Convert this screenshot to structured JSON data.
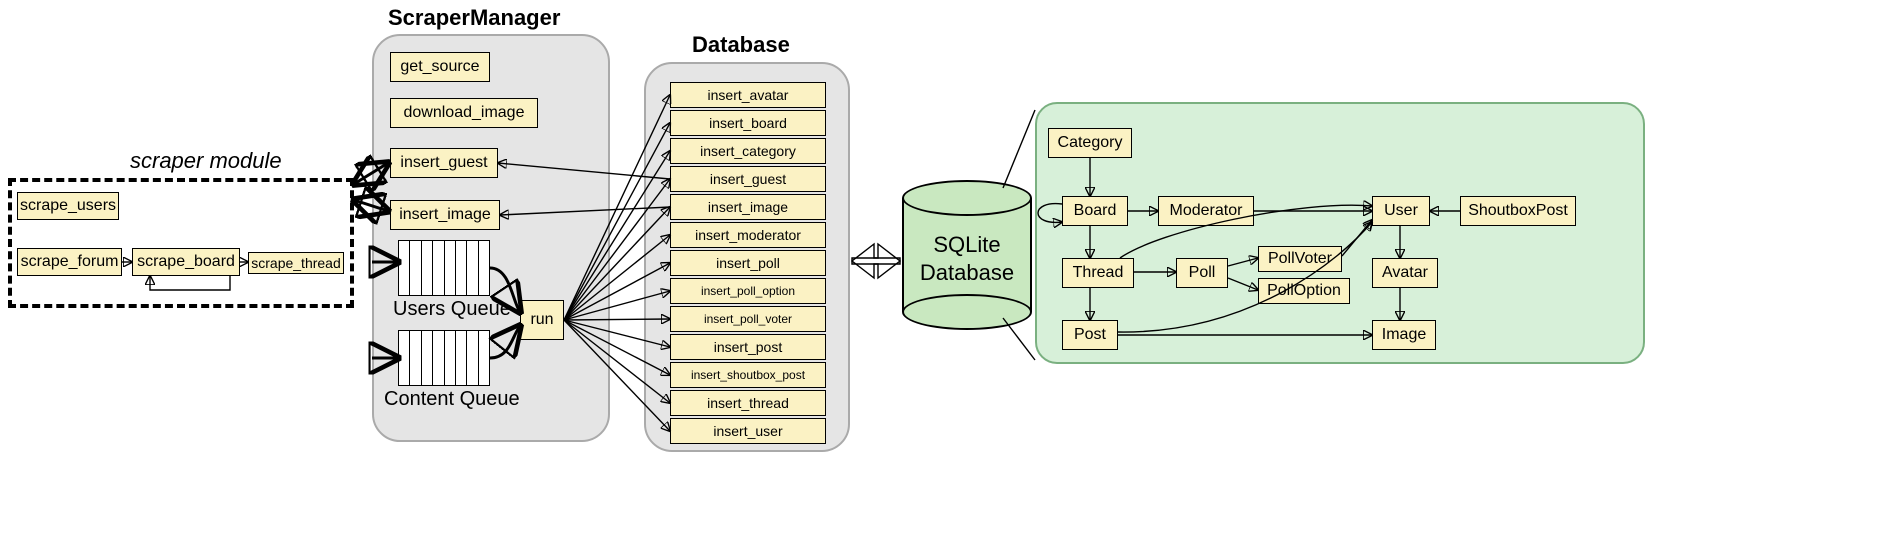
{
  "titles": {
    "scraper_module": "scraper module",
    "scraper_manager": "ScraperManager",
    "database": "Database",
    "users_queue": "Users Queue",
    "content_queue": "Content Queue",
    "sqlite": {
      "line1": "SQLite",
      "line2": "Database"
    }
  },
  "scraper_module": {
    "scrape_users": "scrape_users",
    "scrape_forum": "scrape_forum",
    "scrape_board": "scrape_board",
    "scrape_thread": "scrape_thread"
  },
  "manager": {
    "get_source": "get_source",
    "download_image": "download_image",
    "insert_guest": "insert_guest",
    "insert_image": "insert_image",
    "run": "run"
  },
  "db_methods": [
    "insert_avatar",
    "insert_board",
    "insert_category",
    "insert_guest",
    "insert_image",
    "insert_moderator",
    "insert_poll",
    "insert_poll_option",
    "insert_poll_voter",
    "insert_post",
    "insert_shoutbox_post",
    "insert_thread",
    "insert_user"
  ],
  "schema": {
    "category": "Category",
    "board": "Board",
    "moderator": "Moderator",
    "user": "User",
    "shoutbox_post": "ShoutboxPost",
    "thread": "Thread",
    "poll": "Poll",
    "poll_voter": "PollVoter",
    "poll_option": "PollOption",
    "avatar": "Avatar",
    "post": "Post",
    "image": "Image"
  }
}
